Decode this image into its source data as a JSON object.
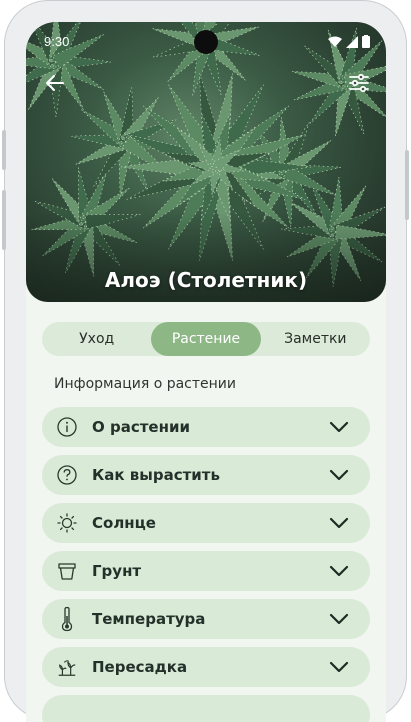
{
  "status_bar": {
    "time": "9:30"
  },
  "header": {
    "title": "Алоэ (Столетник)"
  },
  "tabs": [
    {
      "label": "Уход",
      "active": false
    },
    {
      "label": "Растение",
      "active": true
    },
    {
      "label": "Заметки",
      "active": false
    }
  ],
  "section": {
    "title": "Информация о растении"
  },
  "items": [
    {
      "label": "О растении",
      "icon": "info-icon"
    },
    {
      "label": "Как вырастить",
      "icon": "question-icon"
    },
    {
      "label": "Солнце",
      "icon": "sun-icon"
    },
    {
      "label": "Грунт",
      "icon": "pot-icon"
    },
    {
      "label": "Температура",
      "icon": "thermometer-icon"
    },
    {
      "label": "Пересадка",
      "icon": "transplant-icon"
    }
  ],
  "colors": {
    "accent": "#8db886",
    "card": "#d9ead6",
    "tab_track": "#dcebd9",
    "background": "#f1f7f0"
  }
}
